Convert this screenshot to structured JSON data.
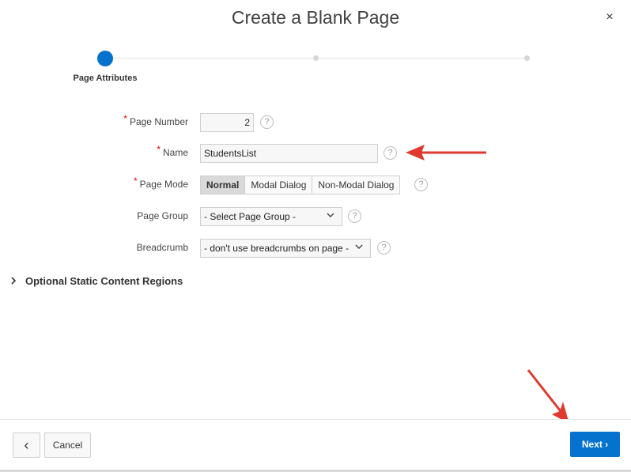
{
  "dialog": {
    "title": "Create a Blank Page",
    "close_icon": "×"
  },
  "wizard": {
    "steps": [
      {
        "label": "Page Attributes",
        "state": "active"
      },
      {
        "label": "",
        "state": "pending"
      },
      {
        "label": "",
        "state": "pending"
      }
    ],
    "accent_color": "#0572ce"
  },
  "form": {
    "page_number": {
      "label": "Page Number",
      "value": "2",
      "required": true,
      "help": "?"
    },
    "name": {
      "label": "Name",
      "value": "StudentsList",
      "required": true,
      "help": "?"
    },
    "page_mode": {
      "label": "Page Mode",
      "required": true,
      "help": "?",
      "options": [
        "Normal",
        "Modal Dialog",
        "Non-Modal Dialog"
      ],
      "selected": "Normal"
    },
    "page_group": {
      "label": "Page Group",
      "value": "- Select Page Group -",
      "help": "?"
    },
    "breadcrumb": {
      "label": "Breadcrumb",
      "value": "- don't use breadcrumbs on page -",
      "help": "?"
    },
    "required_marker": "*"
  },
  "regions": {
    "optional_static": {
      "label": "Optional Static Content Regions",
      "icon": "chevron-right-icon"
    }
  },
  "footer": {
    "back_icon": "‹",
    "cancel_label": "Cancel",
    "next_label": "Next",
    "next_icon": "›"
  },
  "colors": {
    "primary": "#0572ce",
    "required": "#e00000",
    "annotation_arrow": "#e03a2e"
  }
}
